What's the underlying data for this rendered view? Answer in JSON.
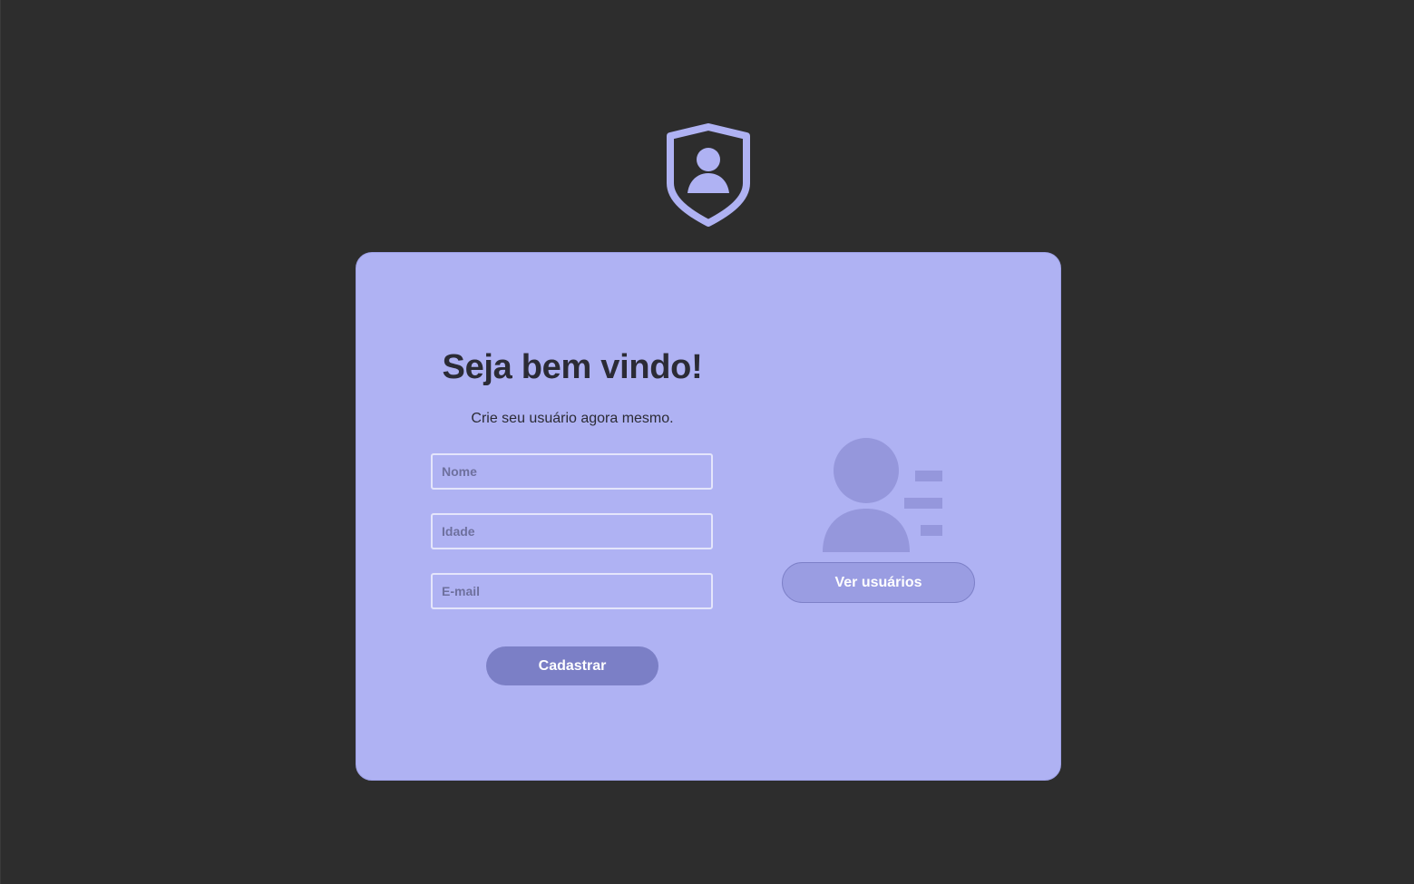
{
  "logo": {
    "icon": "shield-user-icon",
    "color": "#afb2f3"
  },
  "form": {
    "title": "Seja bem vindo!",
    "subtitle": "Crie seu usuário agora mesmo.",
    "fields": [
      {
        "placeholder": "Nome",
        "value": ""
      },
      {
        "placeholder": "Idade",
        "value": ""
      },
      {
        "placeholder": "E-mail",
        "value": ""
      }
    ],
    "submit_label": "Cadastrar"
  },
  "side": {
    "illustration_icon": "user-list-icon",
    "view_users_label": "Ver usuários"
  },
  "colors": {
    "background": "#2d2d2d",
    "card": "#afb2f3",
    "primary_button": "#7b7fc6",
    "secondary_button": "#9a9de2",
    "illustration": "#9597dc",
    "text": "#2b2b35"
  }
}
